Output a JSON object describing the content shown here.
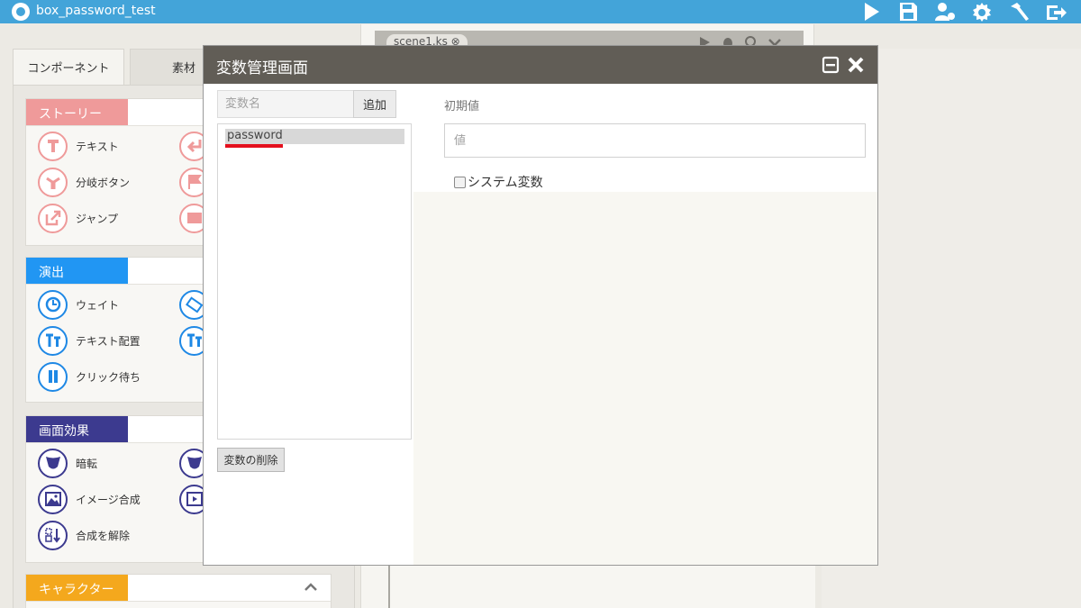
{
  "topbar": {
    "title": "box_password_test",
    "icons": [
      "play-icon",
      "save-icon",
      "users-gear-icon",
      "settings-icon",
      "hammer-icon",
      "export-icon"
    ]
  },
  "left_panel": {
    "tabs": [
      {
        "label": "コンポーネント"
      },
      {
        "label": "素材"
      }
    ],
    "sections": [
      {
        "label": "ストーリー",
        "color": "#ef9a9a",
        "items": [
          {
            "label": "テキスト",
            "icon": "text-t-icon"
          },
          {
            "label": "分岐ボタン",
            "icon": "branch-icon"
          },
          {
            "label": "ジャンプ",
            "icon": "jump-icon"
          },
          {
            "label": "",
            "icon": "return-arrow-icon"
          },
          {
            "label": "",
            "icon": "flag-icon"
          },
          {
            "label": "",
            "icon": "window-icon"
          }
        ]
      },
      {
        "label": "演出",
        "color": "#2196f3",
        "items": [
          {
            "label": "ウェイト",
            "icon": "clock-icon"
          },
          {
            "label": "テキスト配置",
            "icon": "text-layout-icon"
          },
          {
            "label": "クリック待ち",
            "icon": "pause-icon"
          },
          {
            "label": "",
            "icon": "phone-rotate-icon"
          },
          {
            "label": "",
            "icon": "text-layout-icon"
          }
        ]
      },
      {
        "label": "画面効果",
        "color": "#3c3a8f",
        "items": [
          {
            "label": "暗転",
            "icon": "fade-icon"
          },
          {
            "label": "イメージ合成",
            "icon": "image-icon"
          },
          {
            "label": "合成を解除",
            "icon": "unmerge-icon"
          },
          {
            "label": "",
            "icon": "fade-icon"
          },
          {
            "label": "",
            "icon": "film-icon"
          }
        ]
      },
      {
        "label": "キャラクター",
        "color": "#f4a81d"
      }
    ]
  },
  "editor": {
    "scene_tab": "scene1.ks ⊗"
  },
  "dialog": {
    "title": "変数管理画面",
    "varname_placeholder": "変数名",
    "add_label": "追加",
    "variables": [
      "password"
    ],
    "delete_label": "変数の削除",
    "initial_value_label": "初期値",
    "initial_value_placeholder": "値",
    "system_var_label": "システム変数",
    "system_var_checked": false
  }
}
